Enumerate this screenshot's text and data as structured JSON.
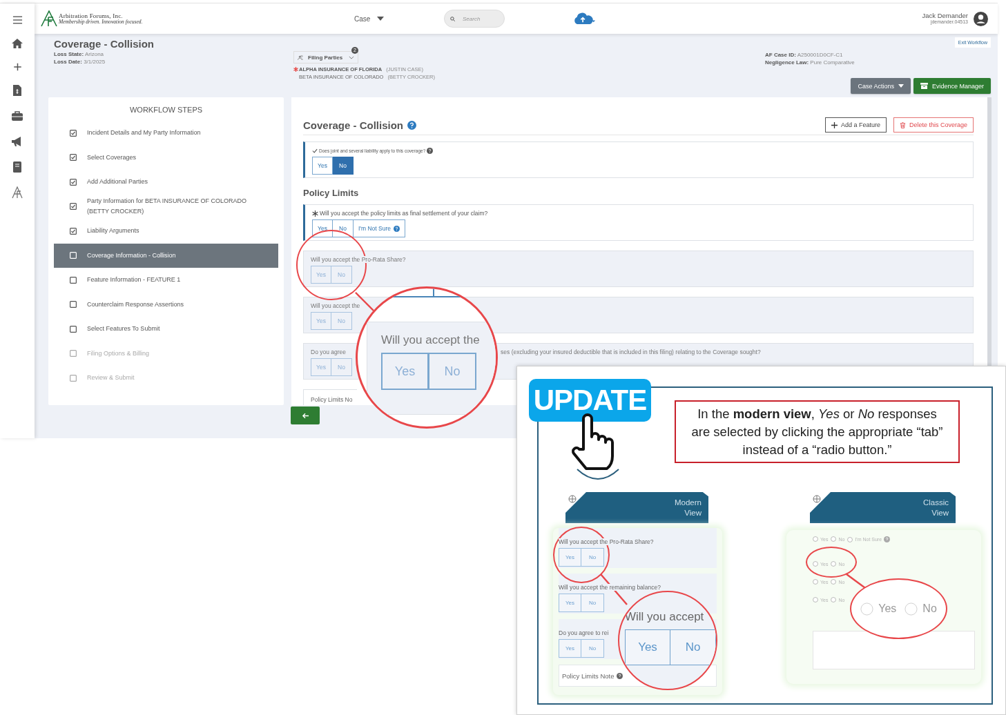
{
  "header": {
    "logo_name": "Arbitration Forums, Inc.",
    "logo_tagline": "Membership driven. Innovation focused.",
    "case_menu": "Case",
    "search": {
      "placeholder": "Search"
    },
    "user": {
      "name": "Jack Demander",
      "id": "jdemander.04513"
    }
  },
  "case_header": {
    "title": "Coverage - Collision",
    "fields": [
      {
        "label": "Loss State:",
        "value": "Arizona"
      },
      {
        "label": "Loss Date:",
        "value": "3/1/2025"
      }
    ],
    "filing_parties": {
      "label": "Filing Parties",
      "count": "2",
      "parties": [
        {
          "name": "ALPHA INSURANCE OF FLORIDA",
          "contact": "(JUSTIN CASE)",
          "primary": true
        },
        {
          "name": "BETA INSURANCE OF COLORADO",
          "contact": "(BETTY CROCKER)",
          "primary": false
        }
      ]
    },
    "case_fields": [
      {
        "label": "AF Case ID:",
        "value": "A250001D0CF-C1"
      },
      {
        "label": "Negligence Law:",
        "value": "Pure Comparative"
      }
    ],
    "exit": "Exit Workflow",
    "buttons": [
      {
        "label": "Case Actions",
        "kind": "dropdown"
      },
      {
        "label": "Evidence Manager",
        "kind": "evidence"
      }
    ]
  },
  "workflow": {
    "title": "WORKFLOW STEPS",
    "steps": [
      {
        "label": "Incident Details and My Party Information",
        "checked": true,
        "selected": false,
        "disabled": false
      },
      {
        "label": "Select Coverages",
        "checked": true,
        "selected": false,
        "disabled": false
      },
      {
        "label": "Add Additional Parties",
        "checked": true,
        "selected": false,
        "disabled": false
      },
      {
        "label": "Party Information for BETA INSURANCE OF COLORADO (BETTY CROCKER)",
        "checked": true,
        "selected": false,
        "disabled": false
      },
      {
        "label": "Liability Arguments",
        "checked": true,
        "selected": false,
        "disabled": false
      },
      {
        "label": "Coverage Information - Collision",
        "checked": false,
        "selected": true,
        "disabled": false
      },
      {
        "label": "Feature Information - FEATURE 1",
        "checked": false,
        "selected": false,
        "disabled": false
      },
      {
        "label": "Counterclaim Response Assertions",
        "checked": false,
        "selected": false,
        "disabled": false
      },
      {
        "label": "Select Features To Submit",
        "checked": false,
        "selected": false,
        "disabled": false
      },
      {
        "label": "Filing Options & Billing",
        "checked": false,
        "selected": false,
        "disabled": true
      },
      {
        "label": "Review & Submit",
        "checked": false,
        "selected": false,
        "disabled": true
      }
    ]
  },
  "form": {
    "title": "Coverage - Collision",
    "actions": [
      {
        "label": "Add a Feature",
        "kind": "add"
      },
      {
        "label": "Delete this Coverage",
        "kind": "delete"
      }
    ],
    "joint": {
      "question": "Does joint and several liability apply to this coverage?",
      "answered": true,
      "options": [
        {
          "label": "Yes",
          "selected": false
        },
        {
          "label": "No",
          "selected": true
        }
      ]
    },
    "section": "Policy Limits",
    "questions": [
      {
        "text": "Will you accept the policy limits as final settlement of your claim?",
        "required": true,
        "disabled": false,
        "options": [
          {
            "label": "Yes",
            "help": false
          },
          {
            "label": "No",
            "help": false
          },
          {
            "label": "I'm Not Sure",
            "help": true
          }
        ]
      },
      {
        "text": "Will you accept the Pro-Rata Share?",
        "required": false,
        "disabled": true,
        "options": [
          {
            "label": "Yes",
            "help": false
          },
          {
            "label": "No",
            "help": false
          }
        ]
      },
      {
        "text": "Will you accept the",
        "required": false,
        "disabled": true,
        "options": [
          {
            "label": "Yes",
            "help": false
          },
          {
            "label": "No",
            "help": false
          }
        ]
      },
      {
        "text": "Do you agree",
        "tail": "ses (excluding your insured deductible that is included in this filing) relating to the Coverage sought?",
        "required": false,
        "disabled": true,
        "options": [
          {
            "label": "Yes",
            "help": false
          },
          {
            "label": "No",
            "help": false
          }
        ]
      }
    ],
    "note_label": "Policy Limits No"
  },
  "magnifier": {
    "text": "Will you accept the",
    "options": [
      "Yes",
      "No"
    ]
  },
  "callout": {
    "badge": "UPDATE",
    "note": "In the **modern view**, *Yes* or *No* responses are selected by clicking the appropriate “tab” instead of a “radio button.”",
    "modern_view": {
      "title": "Modern View",
      "questions": [
        {
          "text": "Will you accept the Pro-Rata Share?",
          "options": [
            "Yes",
            "No"
          ]
        },
        {
          "text": "Will you accept the remaining balance?",
          "options": [
            "Yes",
            "No"
          ]
        },
        {
          "text": "Do you agree to rei",
          "options": [
            "Yes",
            "No"
          ]
        }
      ],
      "note_label": "Policy Limits Note",
      "magnifier": {
        "text": "Will you accept",
        "options": [
          "Yes",
          "No"
        ]
      }
    },
    "classic_view": {
      "title": "Classic View",
      "rows": [
        {
          "options": [
            {
              "label": "Yes",
              "help": false,
              "selected": false
            },
            {
              "label": "No",
              "help": false,
              "selected": false
            },
            {
              "label": "I'm Not Sure",
              "help": true,
              "selected": false
            }
          ]
        },
        {
          "options": [
            {
              "label": "Yes",
              "help": false,
              "selected": false
            },
            {
              "label": "No",
              "help": false,
              "selected": false
            }
          ]
        },
        {
          "options": [
            {
              "label": "Yes",
              "help": false,
              "selected": false
            },
            {
              "label": "No",
              "help": false,
              "selected": false
            }
          ]
        },
        {
          "options": [
            {
              "label": "Yes",
              "help": false,
              "selected": false
            },
            {
              "label": "No",
              "help": false,
              "selected": false
            }
          ]
        }
      ],
      "magnifier": {
        "options": [
          {
            "label": "Yes",
            "selected": false
          },
          {
            "label": "No",
            "selected": false
          }
        ]
      }
    }
  }
}
